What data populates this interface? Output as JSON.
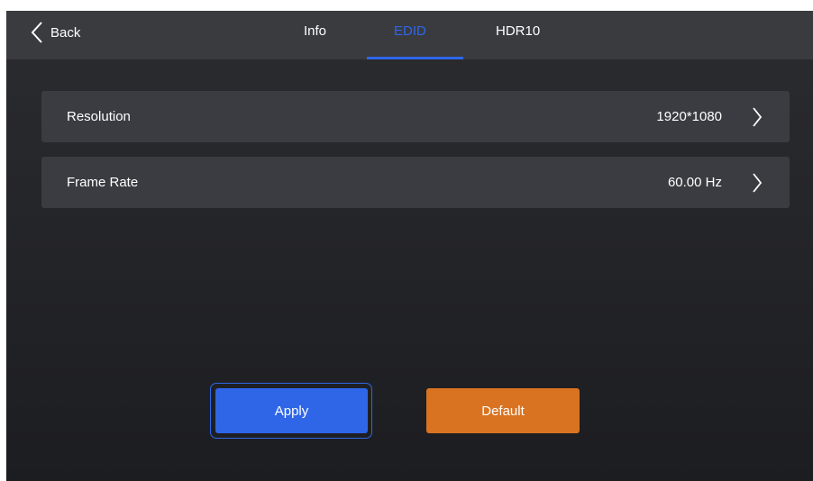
{
  "header": {
    "back_label": "Back",
    "tabs": [
      {
        "label": "Info"
      },
      {
        "label": "EDID"
      },
      {
        "label": "HDR10"
      }
    ],
    "active_tab": "EDID"
  },
  "settings": [
    {
      "label": "Resolution",
      "value": "1920*1080"
    },
    {
      "label": "Frame Rate",
      "value": "60.00 Hz"
    }
  ],
  "actions": {
    "apply_label": "Apply",
    "default_label": "Default"
  },
  "colors": {
    "accent": "#2f66e8",
    "default_button": "#d97321",
    "background": "#2b2c30",
    "row": "#3b3c41"
  },
  "icons": {
    "back": "chevron-left-icon",
    "row_arrow": "chevron-right-icon"
  }
}
